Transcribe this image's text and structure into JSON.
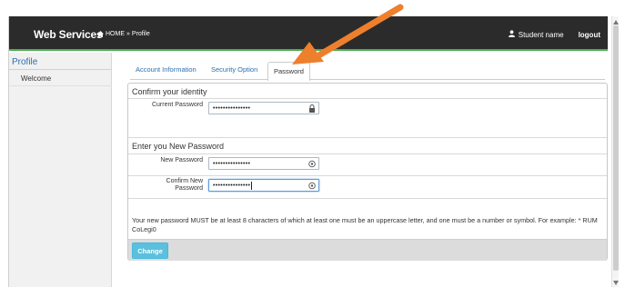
{
  "navbar": {
    "brand": "Web Services",
    "breadcrumb_home": "HOME",
    "breadcrumb_sep": "»",
    "breadcrumb_current": "Profile",
    "user_name": "Student name",
    "logout": "logout",
    "accent_color": "#4caf50"
  },
  "sidebar": {
    "title": "Profile",
    "items": [
      {
        "label": "Welcome"
      }
    ]
  },
  "tabs": [
    {
      "label": "Account Information",
      "active": false
    },
    {
      "label": "Security Option",
      "active": false
    },
    {
      "label": "Password",
      "active": true
    }
  ],
  "form": {
    "section1_title": "Confirm your identity",
    "current_password_label": "Current Password",
    "current_password_value": "•••••••••••••••",
    "section2_title": "Enter you New Password",
    "new_password_label": "New Password",
    "new_password_value": "•••••••••••••••",
    "confirm_password_label_line1": "Confirm New",
    "confirm_password_label_line2": "Password",
    "confirm_password_value": "•••••••••••••••",
    "notice": "Your new password MUST be at least 8 characters of which at least one must be an uppercase letter, and one must be a number or symbol. For example: * RUM CoLegi0",
    "change_button": "Change",
    "button_color": "#5bc0de"
  },
  "annotation": {
    "arrow_color": "#ee7f2d",
    "icon": "arrow-pointer-icon"
  }
}
